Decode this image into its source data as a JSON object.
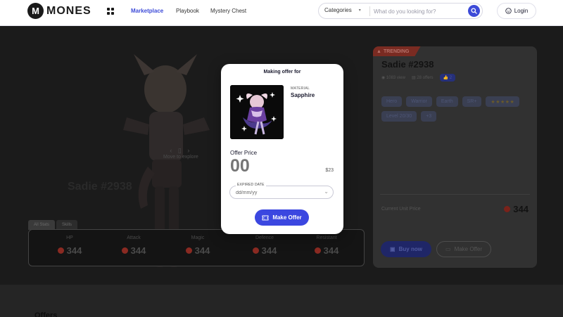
{
  "header": {
    "logo_letter": "M",
    "brand": "MONES",
    "nav": [
      "Marketplace",
      "Playbook",
      "Mystery Chest"
    ],
    "search": {
      "category": "Categories",
      "placeholder": "What do you looking for?"
    },
    "login": "Login"
  },
  "hero": {
    "explore_hint": "Move to explore",
    "stat_tabs": [
      "All Stats",
      "Skills"
    ],
    "stats": [
      {
        "label": "HP",
        "value": "344"
      },
      {
        "label": "Attack",
        "value": "344"
      },
      {
        "label": "Magic",
        "value": "344"
      },
      {
        "label": "Defence",
        "value": "344"
      },
      {
        "label": "Resistant",
        "value": "344"
      }
    ]
  },
  "card": {
    "trending": "TRENDING",
    "title": "Sadie #2938",
    "views": "1083 view",
    "offers": "28 offers",
    "likes": "2",
    "tags": [
      "Hero",
      "Warrior",
      "Earth",
      "SR+",
      "★★★★★",
      "Level 20/30",
      "+3"
    ],
    "price_label": "Current Unit Price",
    "price": "344",
    "buy": "Buy now",
    "make_offer": "Make Offer"
  },
  "section": {
    "offers_title": "Offers"
  },
  "modal": {
    "title": "Making offer for",
    "material_label": "MATERIAL",
    "material_name": "Sapphire",
    "offer_label": "Offer Price",
    "offer_value": "00",
    "usd": "$23",
    "date_label": "EXPIRED DATE",
    "date_placeholder": "dd/mm/yy",
    "submit": "Make Offer"
  },
  "colors": {
    "accent": "#3b47e0",
    "coin": "#c0392b",
    "trending": "#c0392b"
  }
}
